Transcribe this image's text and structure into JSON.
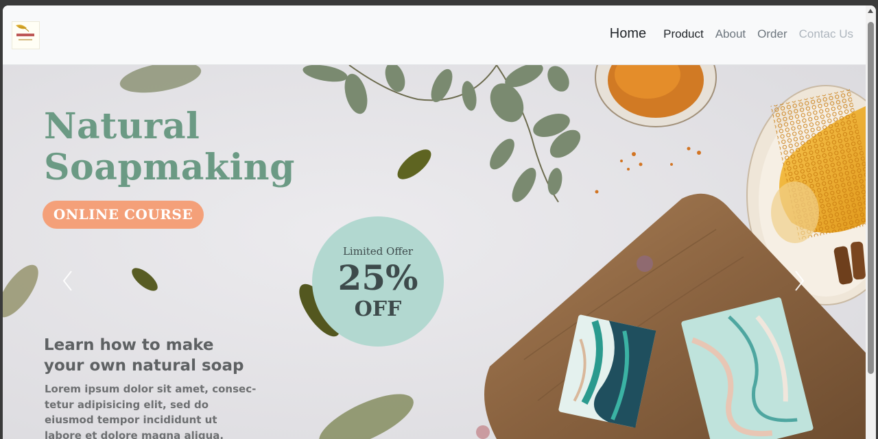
{
  "app": {
    "logo": "logo-image"
  },
  "nav": {
    "home": "Home",
    "product": "Product",
    "about": "About",
    "order": "Order",
    "contact": "Contac Us"
  },
  "hero": {
    "title_line1": "Natural",
    "title_line2": "Soapmaking",
    "badge": "ONLINE COURSE",
    "offer": {
      "line1": "Limited Offer",
      "line2": "25%",
      "line3": "OFF"
    },
    "subheading_line1": "Learn how to make",
    "subheading_line2": "your own natural soap",
    "body": "Lorem ipsum dolor sit amet, consec-tetur adipisicing elit, sed do eiusmod tempor incididunt ut labore et dolore magna aliqua."
  },
  "colors": {
    "title": "#6b9a84",
    "badge": "#f4a079",
    "offer_circle": "#b2d8d0",
    "hero_bg": "#e8e7ea"
  },
  "icons": {
    "prev": "chevron-left-icon",
    "next": "chevron-right-icon"
  }
}
